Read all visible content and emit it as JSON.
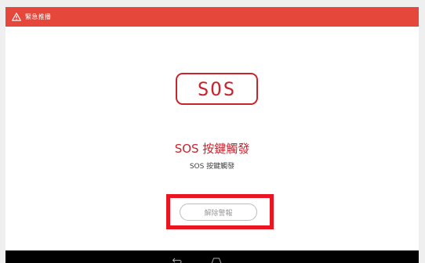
{
  "header": {
    "icon": "warning-icon",
    "title": "緊急推播",
    "background": "#e5473a"
  },
  "logo": {
    "text": "SOS",
    "color": "#c8242e"
  },
  "alert": {
    "title": "SOS 按鍵觸發",
    "subtitle": "SOS 按鍵觸發"
  },
  "actions": {
    "dismiss_label": "解除警報",
    "highlight_color": "#ea1520"
  },
  "nav_bar": {
    "icons": [
      "back-icon",
      "home-icon"
    ]
  }
}
